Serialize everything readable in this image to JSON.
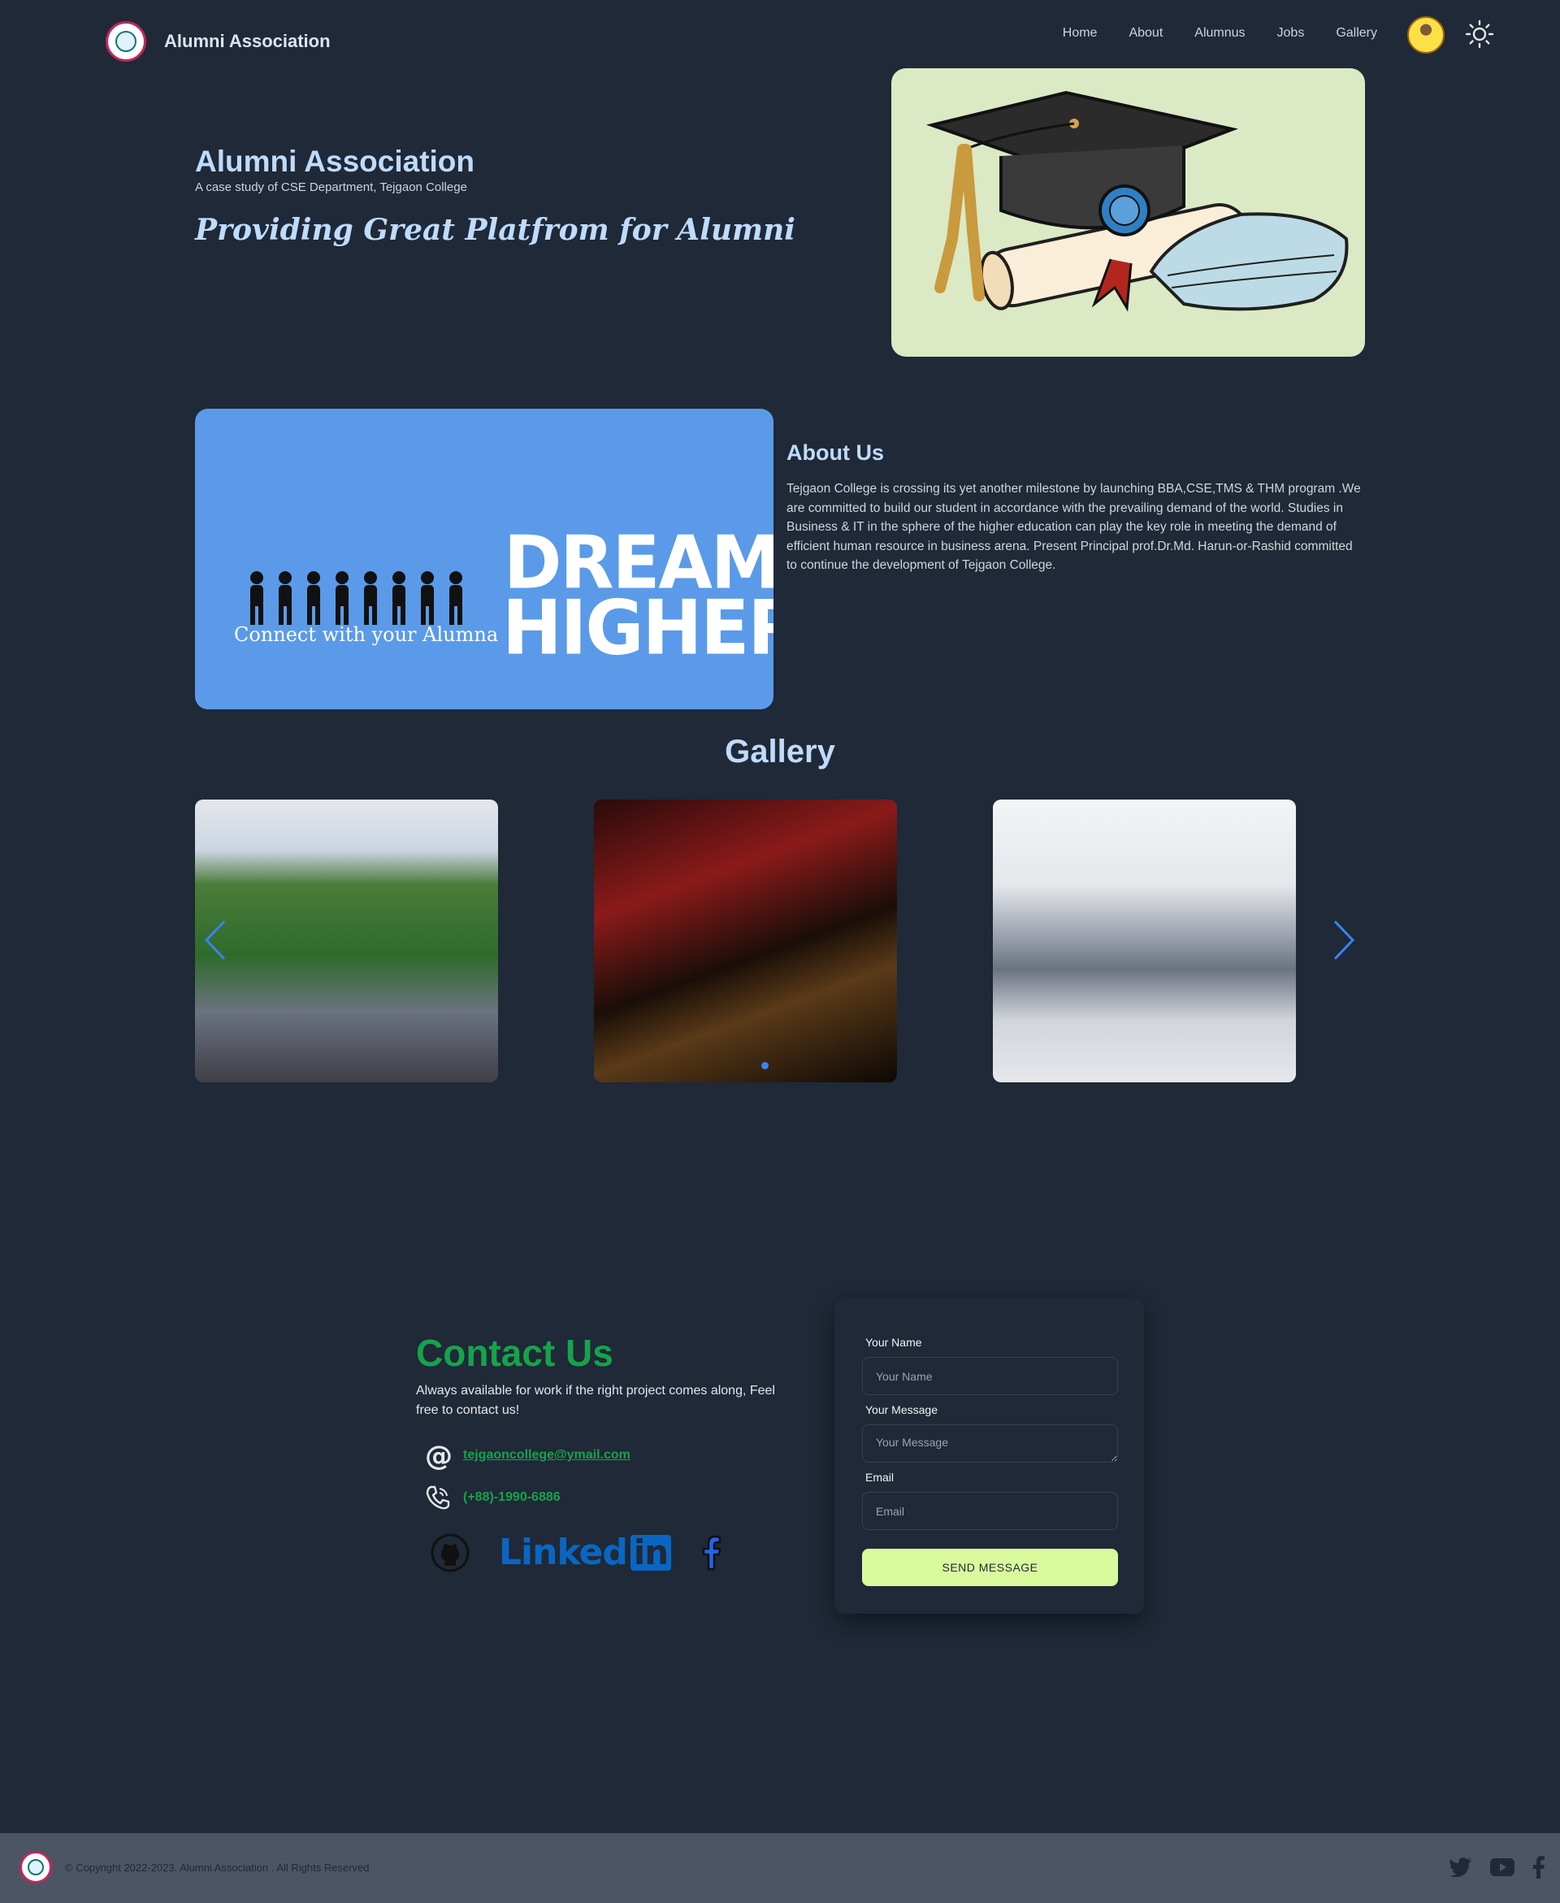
{
  "navbar": {
    "brand": "Alumni Association",
    "links": [
      "Home",
      "About",
      "Alumnus",
      "Jobs",
      "Gallery"
    ]
  },
  "hero": {
    "title": "Alumni Association",
    "subtitle": "A case study of CSE Department, Tejgaon College",
    "tagline": "Providing Great Platfrom for Alumni"
  },
  "about": {
    "banner_line1": "DREAM",
    "banner_line2": "HIGHER",
    "banner_caption": "Connect with your Alumna",
    "title": "About Us",
    "text": "Tejgaon College is crossing its yet another milestone by launching BBA,CSE,TMS & THM program .We are committed to build our student in accordance with the prevailing demand of the world. Studies in Business & IT in the sphere of the higher education can play the key role in meeting the demand of efficient human resource in business arena. Present Principal prof.Dr.Md. Harun-or-Rashid committed to continue the development of Tejgaon College."
  },
  "gallery": {
    "title": "Gallery",
    "images": [
      "college-building-photo",
      "illuminated-gate-photo",
      "auditorium-speech-photo"
    ],
    "active_index": 1
  },
  "contact": {
    "title": "Contact Us",
    "description": "Always available for work if the right project comes along, Feel free to contact us!",
    "email": "tejgaoncollege@ymail.com",
    "phone": "(+88)-1990-6886",
    "linkedin_text": "Linked",
    "linkedin_badge": "in",
    "form": {
      "name_label": "Your Name",
      "name_placeholder": "Your Name",
      "message_label": "Your Message",
      "message_placeholder": "Your Message",
      "email_label": "Email",
      "email_placeholder": "Email",
      "submit": "SEND MESSAGE"
    }
  },
  "footer": {
    "copyright": "© Copyright 2022-2023. Alumni Association . All Rights Reserved"
  },
  "colors": {
    "background": "#1f2937",
    "heading": "#bfdbfe",
    "accent_green": "#16a34a",
    "button": "#d9f99d",
    "banner": "#5b9ae8",
    "footer": "#4b5563"
  }
}
